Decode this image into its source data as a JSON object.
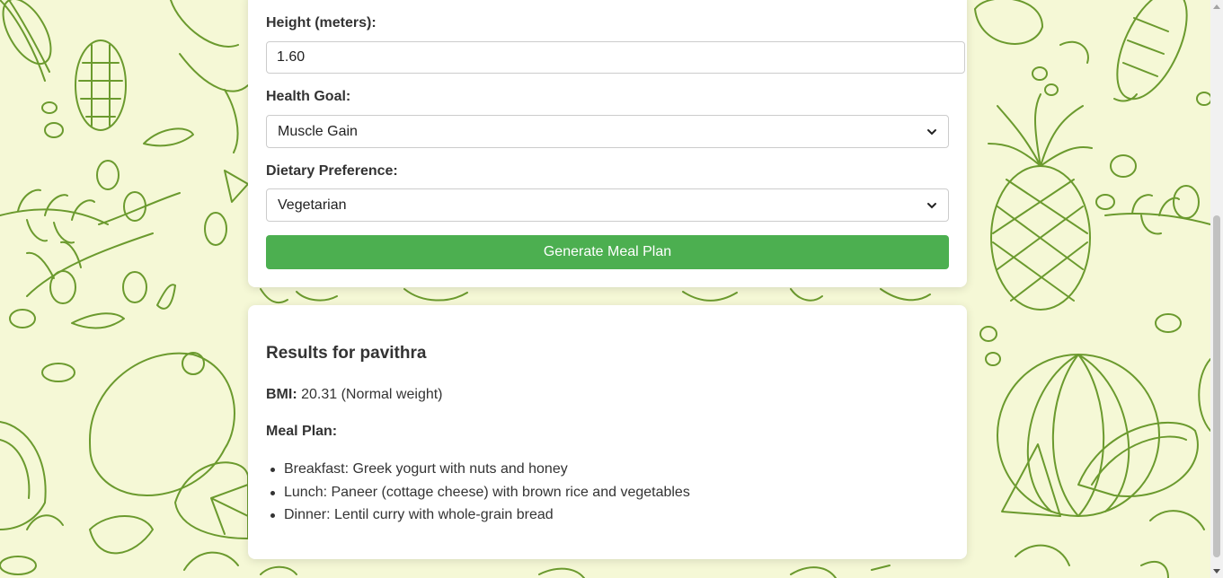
{
  "form": {
    "height_label": "Height (meters):",
    "height_value": "1.60",
    "goal_label": "Health Goal:",
    "goal_selected": "Muscle Gain",
    "diet_label": "Dietary Preference:",
    "diet_selected": "Vegetarian",
    "generate_button": "Generate Meal Plan"
  },
  "results": {
    "title": "Results for pavithra",
    "bmi_label": "BMI:",
    "bmi_value": "20.31 (Normal weight)",
    "meal_plan_label": "Meal Plan:",
    "meals": [
      "Breakfast: Greek yogurt with nuts and honey",
      "Lunch: Paneer (cottage cheese) with brown rice and vegetables",
      "Dinner: Lentil curry with whole-grain bread"
    ]
  },
  "colors": {
    "background": "#f5f8d6",
    "doodle": "#6b9a2e",
    "button": "#4caf50",
    "card": "#ffffff"
  },
  "icons": {
    "select_arrow": "chevron-down-icon"
  }
}
